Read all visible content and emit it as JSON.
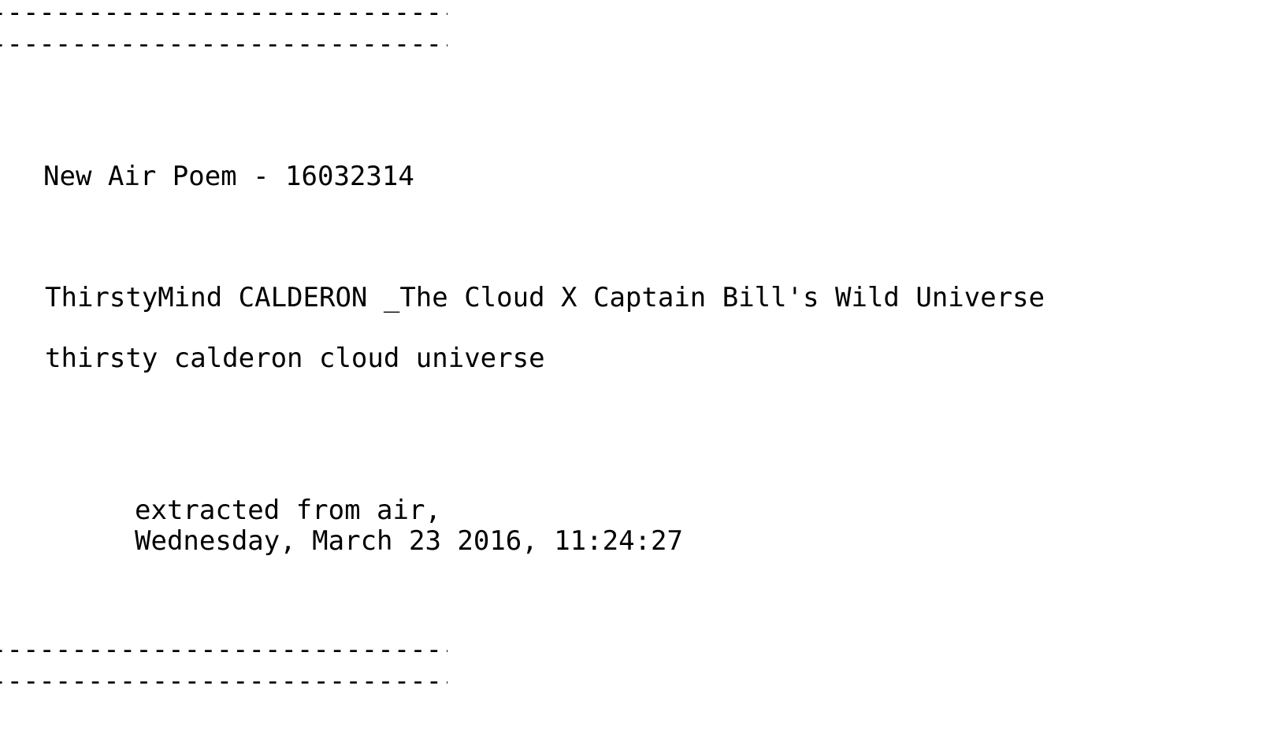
{
  "separators": {
    "top_1": "-----------------------------",
    "top_2": "-----------------------------",
    "bottom_1": "-----------------------------",
    "bottom_2": "-----------------------------"
  },
  "poem": {
    "title": "New Air Poem - 16032314",
    "line_1": "ThirstyMind CALDERON _The Cloud X Captain Bill's Wild Universe",
    "line_2": "thirsty calderon cloud universe"
  },
  "extraction": {
    "label": "extracted from air,",
    "timestamp": "Wednesday, March 23 2016, 11:24:27"
  }
}
